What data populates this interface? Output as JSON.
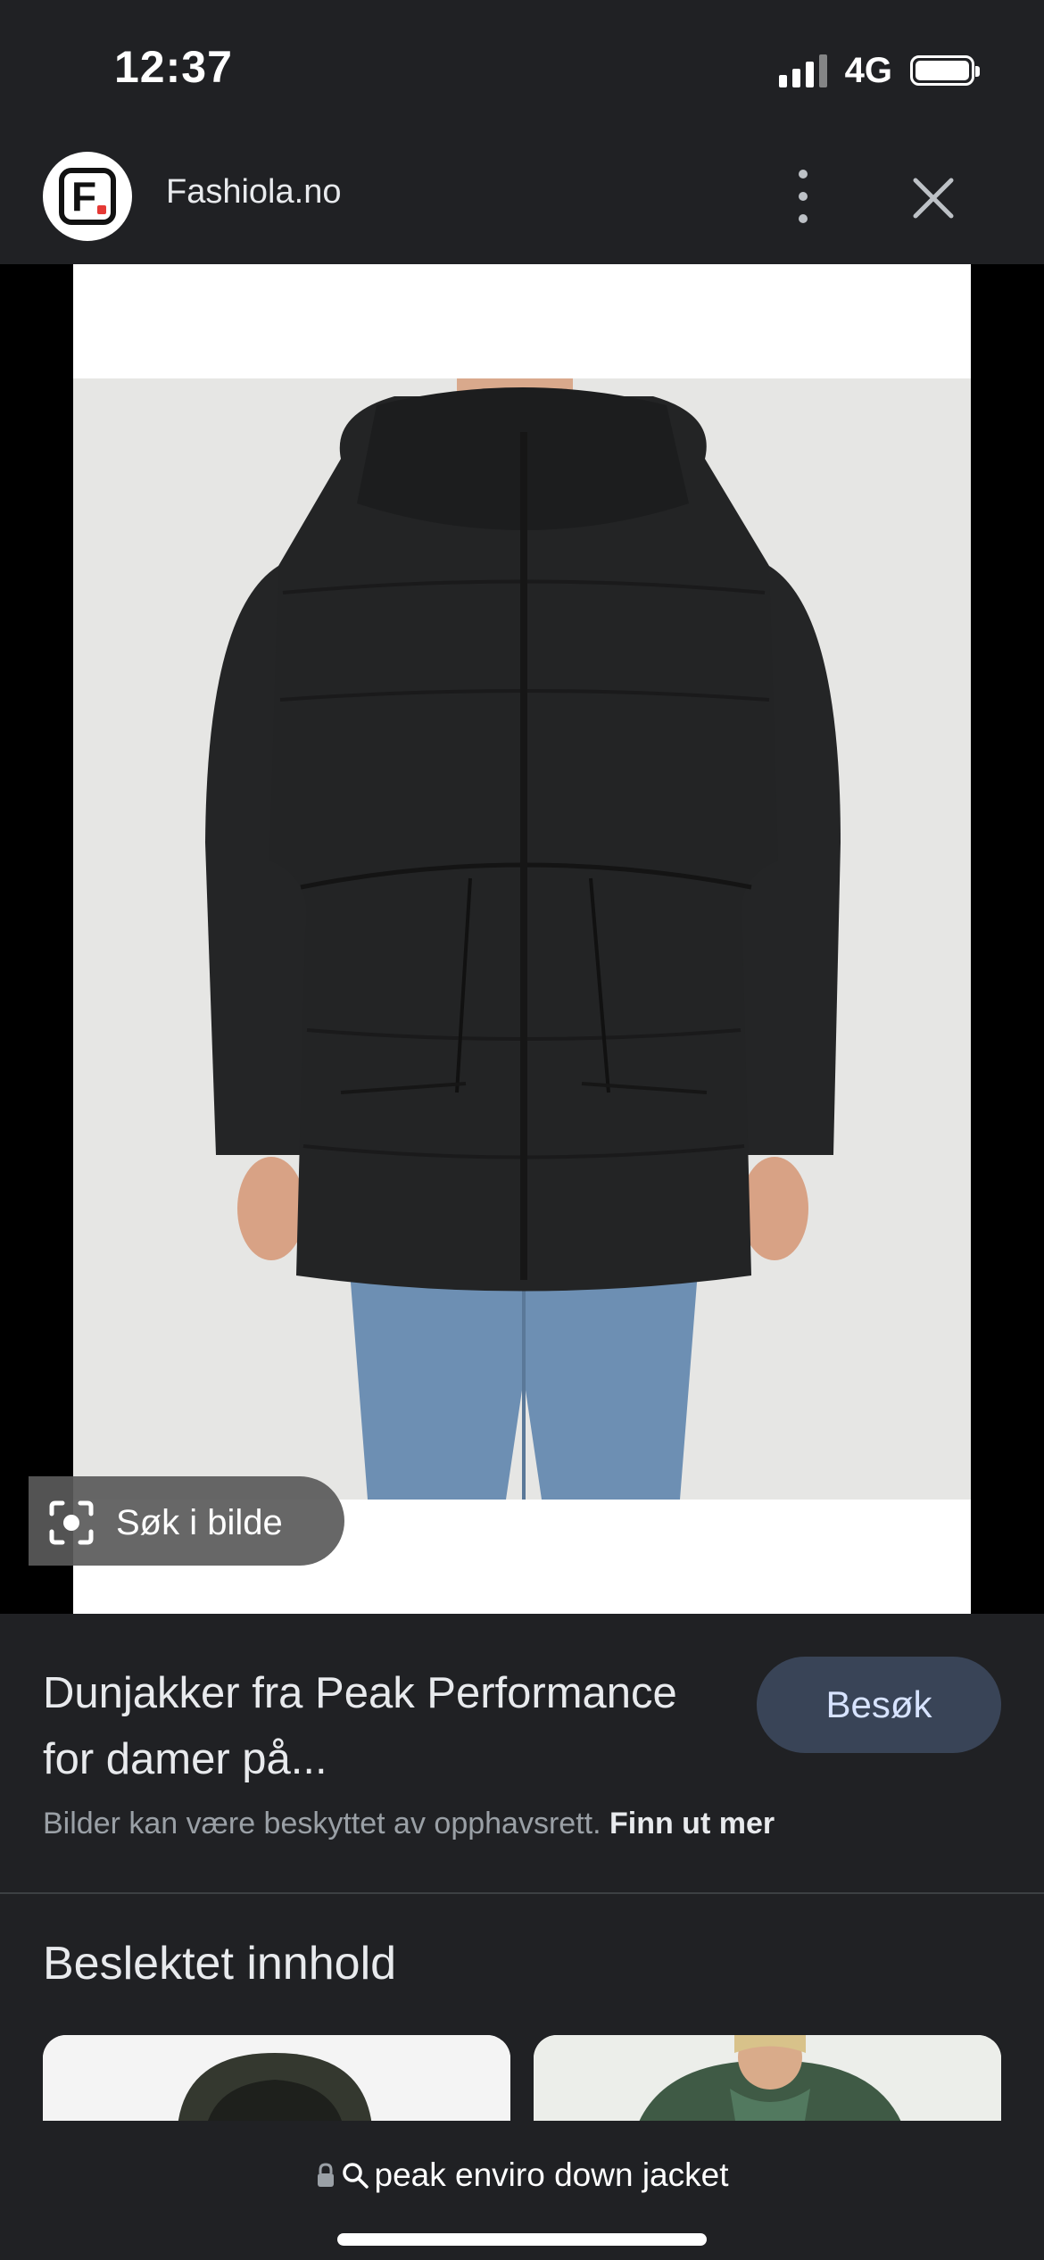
{
  "status_bar": {
    "time": "12:37",
    "network": "4G"
  },
  "header": {
    "site_name": "Fashiola.no"
  },
  "image": {
    "lens_label": "Søk i bilde"
  },
  "result": {
    "title": "Dunjakker fra Peak Performance for damer på...",
    "visit_label": "Besøk",
    "copyright_text": "Bilder kan være beskyttet av opphavsrett.",
    "learn_more": "Finn ut mer"
  },
  "related": {
    "heading": "Beslektet innhold"
  },
  "browser": {
    "url": "peak enviro down jacket"
  },
  "colors": {
    "background": "#202124",
    "button_bg": "#394457",
    "button_text": "#d7e3ff",
    "muted_text": "#9aa0a6"
  }
}
